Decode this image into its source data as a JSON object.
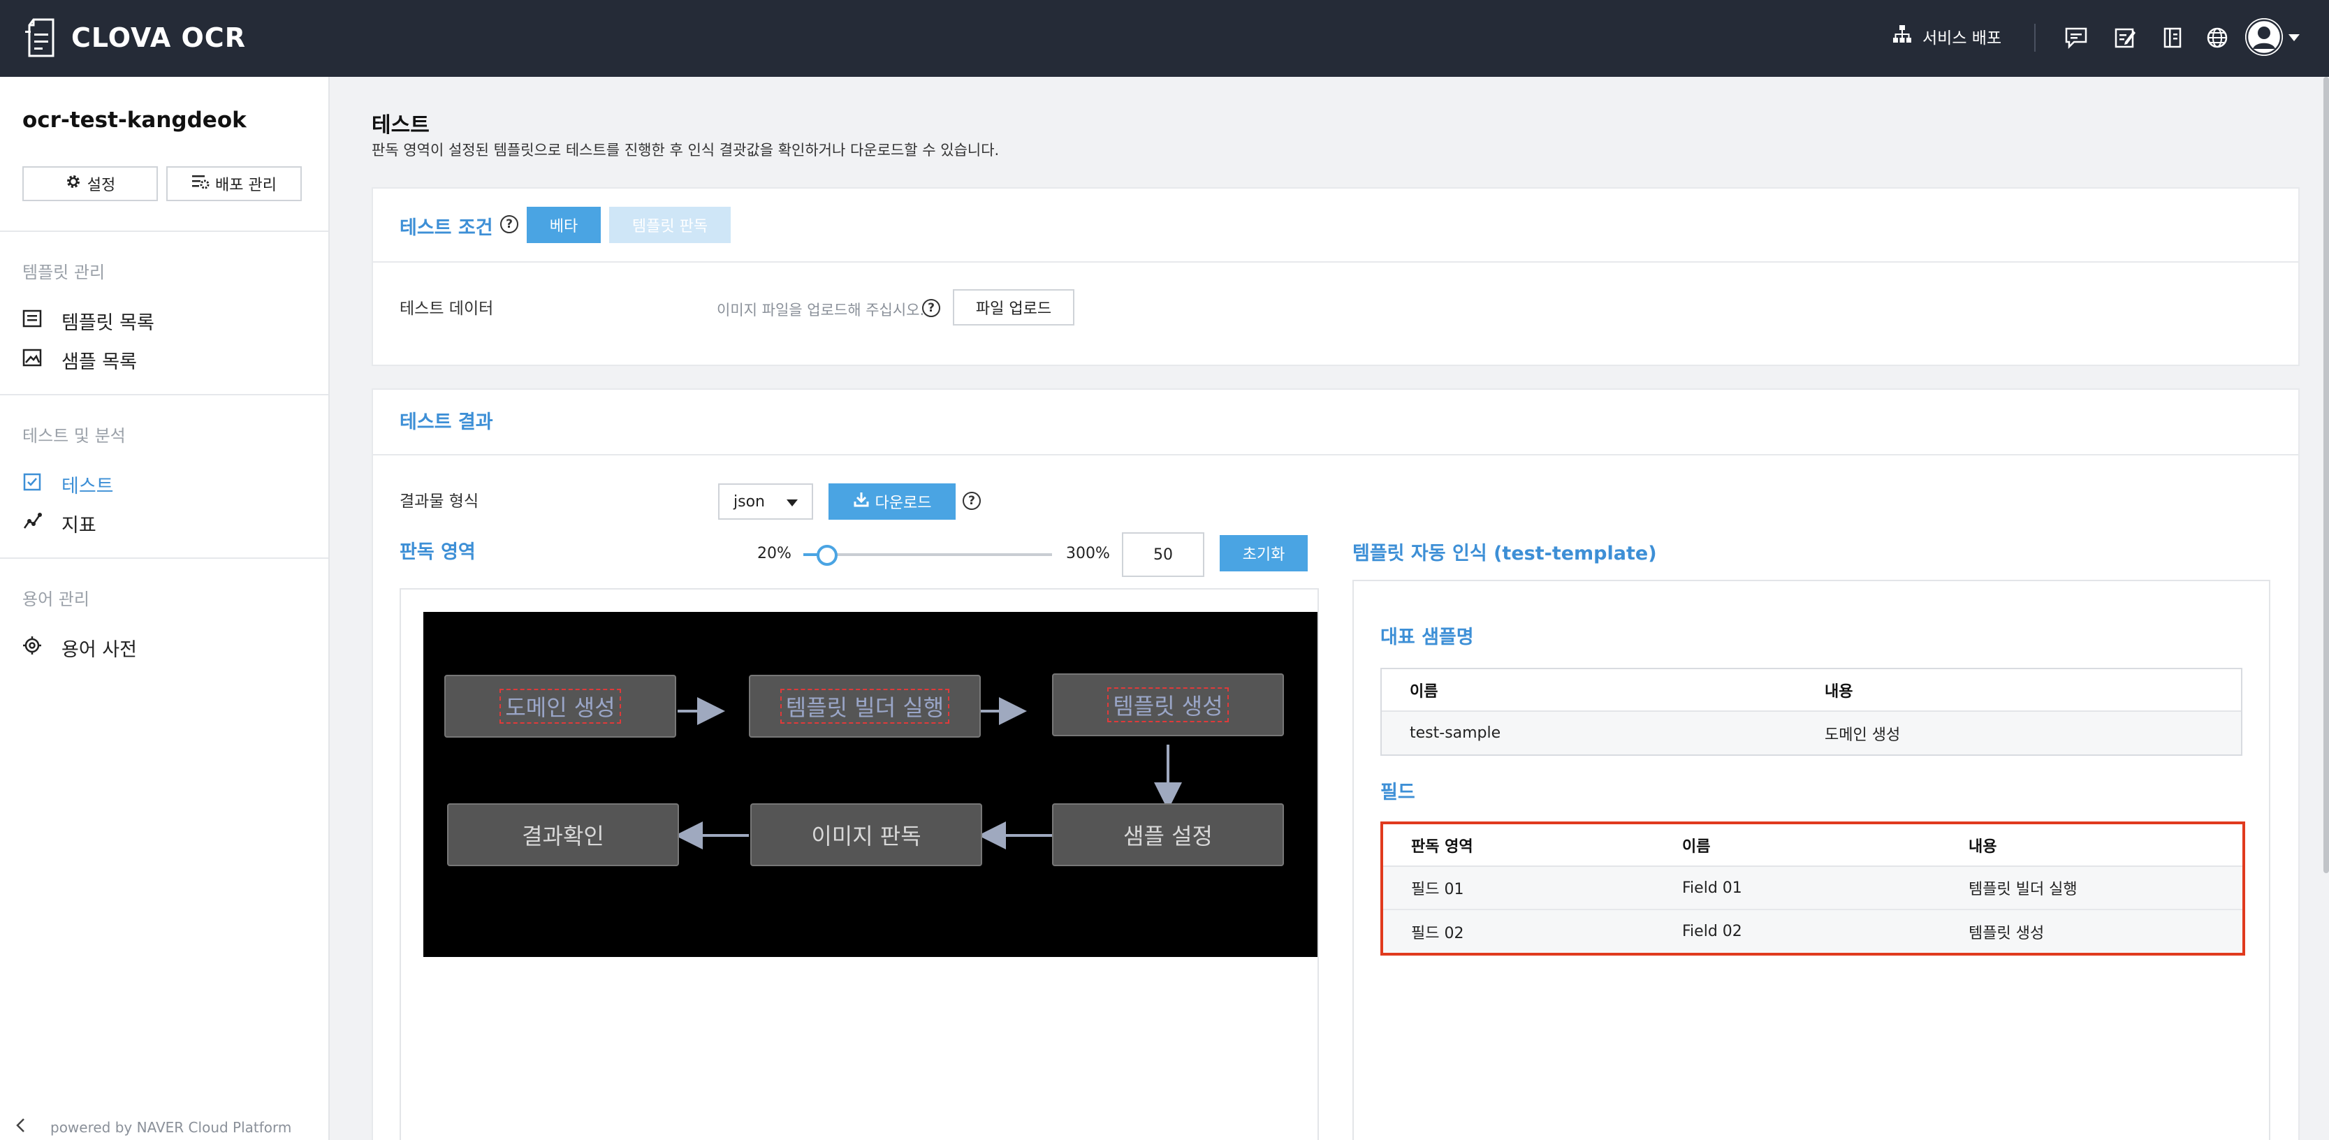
{
  "app": {
    "title": "CLOVA OCR",
    "logo_icon": "document-icon"
  },
  "topbar": {
    "deploy_label": "서비스 배포",
    "icons": [
      "chat-icon",
      "edit-note-icon",
      "book-icon",
      "globe-icon",
      "user-avatar-icon",
      "caret-down-icon"
    ]
  },
  "sidebar": {
    "project_name": "ocr-test-kangdeok",
    "settings_label": "설정",
    "deploy_manage_label": "배포 관리",
    "sections": [
      {
        "title": "템플릿 관리",
        "items": [
          {
            "label": "템플릿 목록",
            "icon": "list-icon"
          },
          {
            "label": "샘플 목록",
            "icon": "image-icon"
          }
        ]
      },
      {
        "title": "테스트 및 분석",
        "items": [
          {
            "label": "테스트",
            "icon": "check-doc-icon",
            "active": true
          },
          {
            "label": "지표",
            "icon": "chart-line-icon"
          }
        ]
      },
      {
        "title": "용어 관리",
        "items": [
          {
            "label": "용어 사전",
            "icon": "target-icon"
          }
        ]
      }
    ],
    "footer": "powered by NAVER Cloud Platform"
  },
  "page": {
    "title": "테스트",
    "description": "판독 영역이 설정된 템플릿으로 테스트를 진행한 후 인식 결괏값을 확인하거나 다운로드할 수 있습니다."
  },
  "test_condition": {
    "title": "테스트 조건",
    "beta_label": "베타",
    "template_read_label": "템플릿 판독",
    "data_label": "테스트 데이터",
    "upload_hint": "이미지 파일을 업로드해 주십시오.",
    "upload_button": "파일 업로드"
  },
  "test_result": {
    "title": "테스트 결과",
    "format_label": "결과물 형식",
    "format_value": "json",
    "download_label": "다운로드",
    "region_title": "판독 영역",
    "zoom_min": "20%",
    "zoom_max": "300%",
    "zoom_value": "50",
    "zoom_fraction": 0.107,
    "reset_label": "초기화",
    "diagram": {
      "boxes": [
        "도메인 생성",
        "템플릿 빌더 실행",
        "템플릿 생성",
        "샘플 설정",
        "이미지 판독",
        "결과확인"
      ]
    },
    "auto_title": "템플릿 자동 인식 (test-template)",
    "rep_sample_title": "대표 샘플명",
    "rep_table": {
      "headers": [
        "이름",
        "내용"
      ],
      "rows": [
        [
          "test-sample",
          "도메인 생성"
        ]
      ]
    },
    "field_title": "필드",
    "field_table": {
      "headers": [
        "판독 영역",
        "이름",
        "내용"
      ],
      "rows": [
        [
          "필드 01",
          "Field 01",
          "템플릿 빌더 실행"
        ],
        [
          "필드 02",
          "Field 02",
          "템플릿 생성"
        ]
      ]
    }
  },
  "colors": {
    "accent": "#3d8fd6",
    "button": "#4aa4e3",
    "topbar": "#252b37",
    "highlight": "#e03a1e"
  }
}
